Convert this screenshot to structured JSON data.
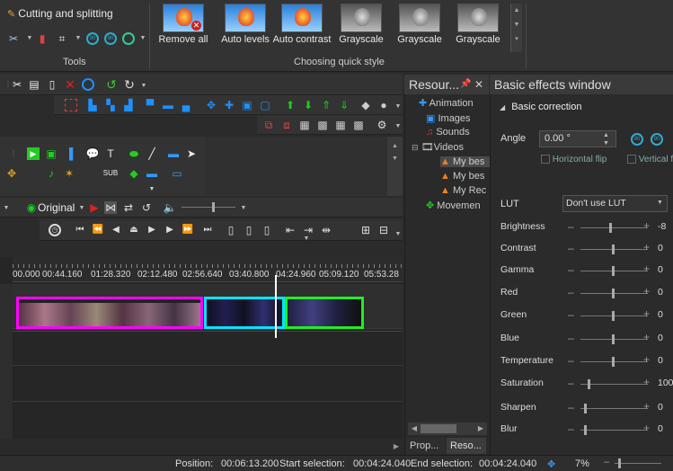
{
  "ribbon": {
    "tools_group": {
      "cutting_label": "Cutting and splitting",
      "caption": "Tools"
    },
    "quick_style": {
      "caption": "Choosing quick style",
      "items": [
        {
          "label": "Remove all",
          "style": "color"
        },
        {
          "label": "Auto levels",
          "style": "color"
        },
        {
          "label": "Auto contrast",
          "style": "color"
        },
        {
          "label": "Grayscale",
          "style": "gray"
        },
        {
          "label": "Grayscale",
          "style": "gray"
        },
        {
          "label": "Grayscale",
          "style": "gray"
        }
      ]
    }
  },
  "timeline": {
    "view_mode": "Original",
    "ruler_ticks": [
      "00.000",
      "00:44.160",
      "01:28.320",
      "02:12.480",
      "02:56.640",
      "03:40.800",
      "04:24.960",
      "05:09.120",
      "05:53.28"
    ]
  },
  "resources": {
    "title": "Resour...",
    "items": [
      "Animation",
      "Images",
      "Sounds",
      "Videos",
      "My bes",
      "My bes",
      "My Rec",
      "Movemen"
    ],
    "tabs": [
      "Prop...",
      "Reso..."
    ]
  },
  "effects": {
    "title": "Basic effects window",
    "section": "Basic correction",
    "angle_label": "Angle",
    "angle_value": "0.00 °",
    "horizontal_flip": "Horizontal flip",
    "vertical_flip": "Vertical fl",
    "lut_label": "LUT",
    "lut_value": "Don't use LUT",
    "sliders": [
      {
        "label": "Brightness",
        "value": "-8",
        "level": 0.45
      },
      {
        "label": "Contrast",
        "value": "0",
        "level": 0.5
      },
      {
        "label": "Gamma",
        "value": "0",
        "level": 0.5
      },
      {
        "label": "Red",
        "value": "0",
        "level": 0.5
      },
      {
        "label": "Green",
        "value": "0",
        "level": 0.5
      },
      {
        "label": "Blue",
        "value": "0",
        "level": 0.5
      },
      {
        "label": "Temperature",
        "value": "0",
        "level": 0.5
      },
      {
        "label": "Saturation",
        "value": "100",
        "level": 0.12
      },
      {
        "label": "Sharpen",
        "value": "0",
        "level": 0.05
      },
      {
        "label": "Blur",
        "value": "0",
        "level": 0.05
      }
    ]
  },
  "statusbar": {
    "position_label": "Position:",
    "position_value": "00:06:13.200",
    "start_label": "Start selection:",
    "start_value": "00:04:24.040",
    "end_label": "End selection:",
    "end_value": "00:04:24.040",
    "zoom": "7%"
  },
  "colors": {
    "clip1": "#ff00ff",
    "clip2": "#00e5ff",
    "clip3": "#22ee22",
    "accent": "#1e90ff"
  }
}
